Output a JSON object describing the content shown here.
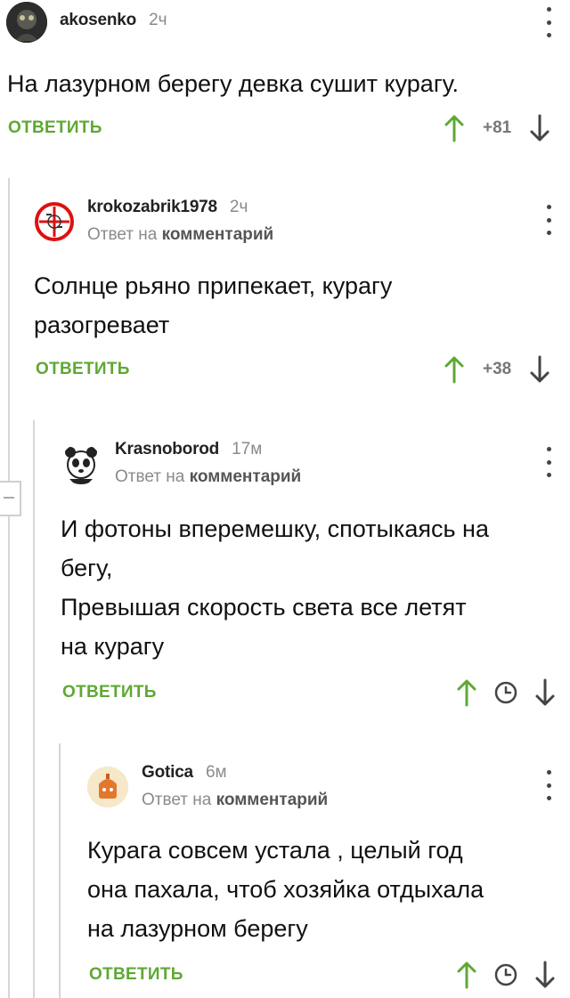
{
  "reply_button": "ОТВЕТИТЬ",
  "reply_to_prefix": "Ответ на",
  "reply_to_link": "комментарий",
  "comments": [
    {
      "author": "akosenko",
      "time": "2ч",
      "text": "На лазурном берегу девка сушит курагу.",
      "score": "+81"
    },
    {
      "author": "krokozabrik1978",
      "time": "2ч",
      "text": "Солнце рьяно припекает, курагу\nразогревает",
      "score": "+38"
    },
    {
      "author": "Krasnoborod",
      "time": "17м",
      "text": "И фотоны вперемешку, спотыкаясь на\nбегу,\nПревышая скорость света все летят\nна курагу"
    },
    {
      "author": "Gotica",
      "time": "6м",
      "text": "Курага совсем устала , целый год\nона пахала, чтоб хозяйка отдыхала\nна лазурном берегу"
    }
  ],
  "colors": {
    "accent_green": "#5fa834",
    "upvote_green": "#5fa834",
    "muted": "#8a8a8a"
  },
  "icons": [
    "avatar",
    "dots-menu-icon",
    "upvote-arrow-icon",
    "downvote-arrow-icon",
    "clock-icon"
  ]
}
